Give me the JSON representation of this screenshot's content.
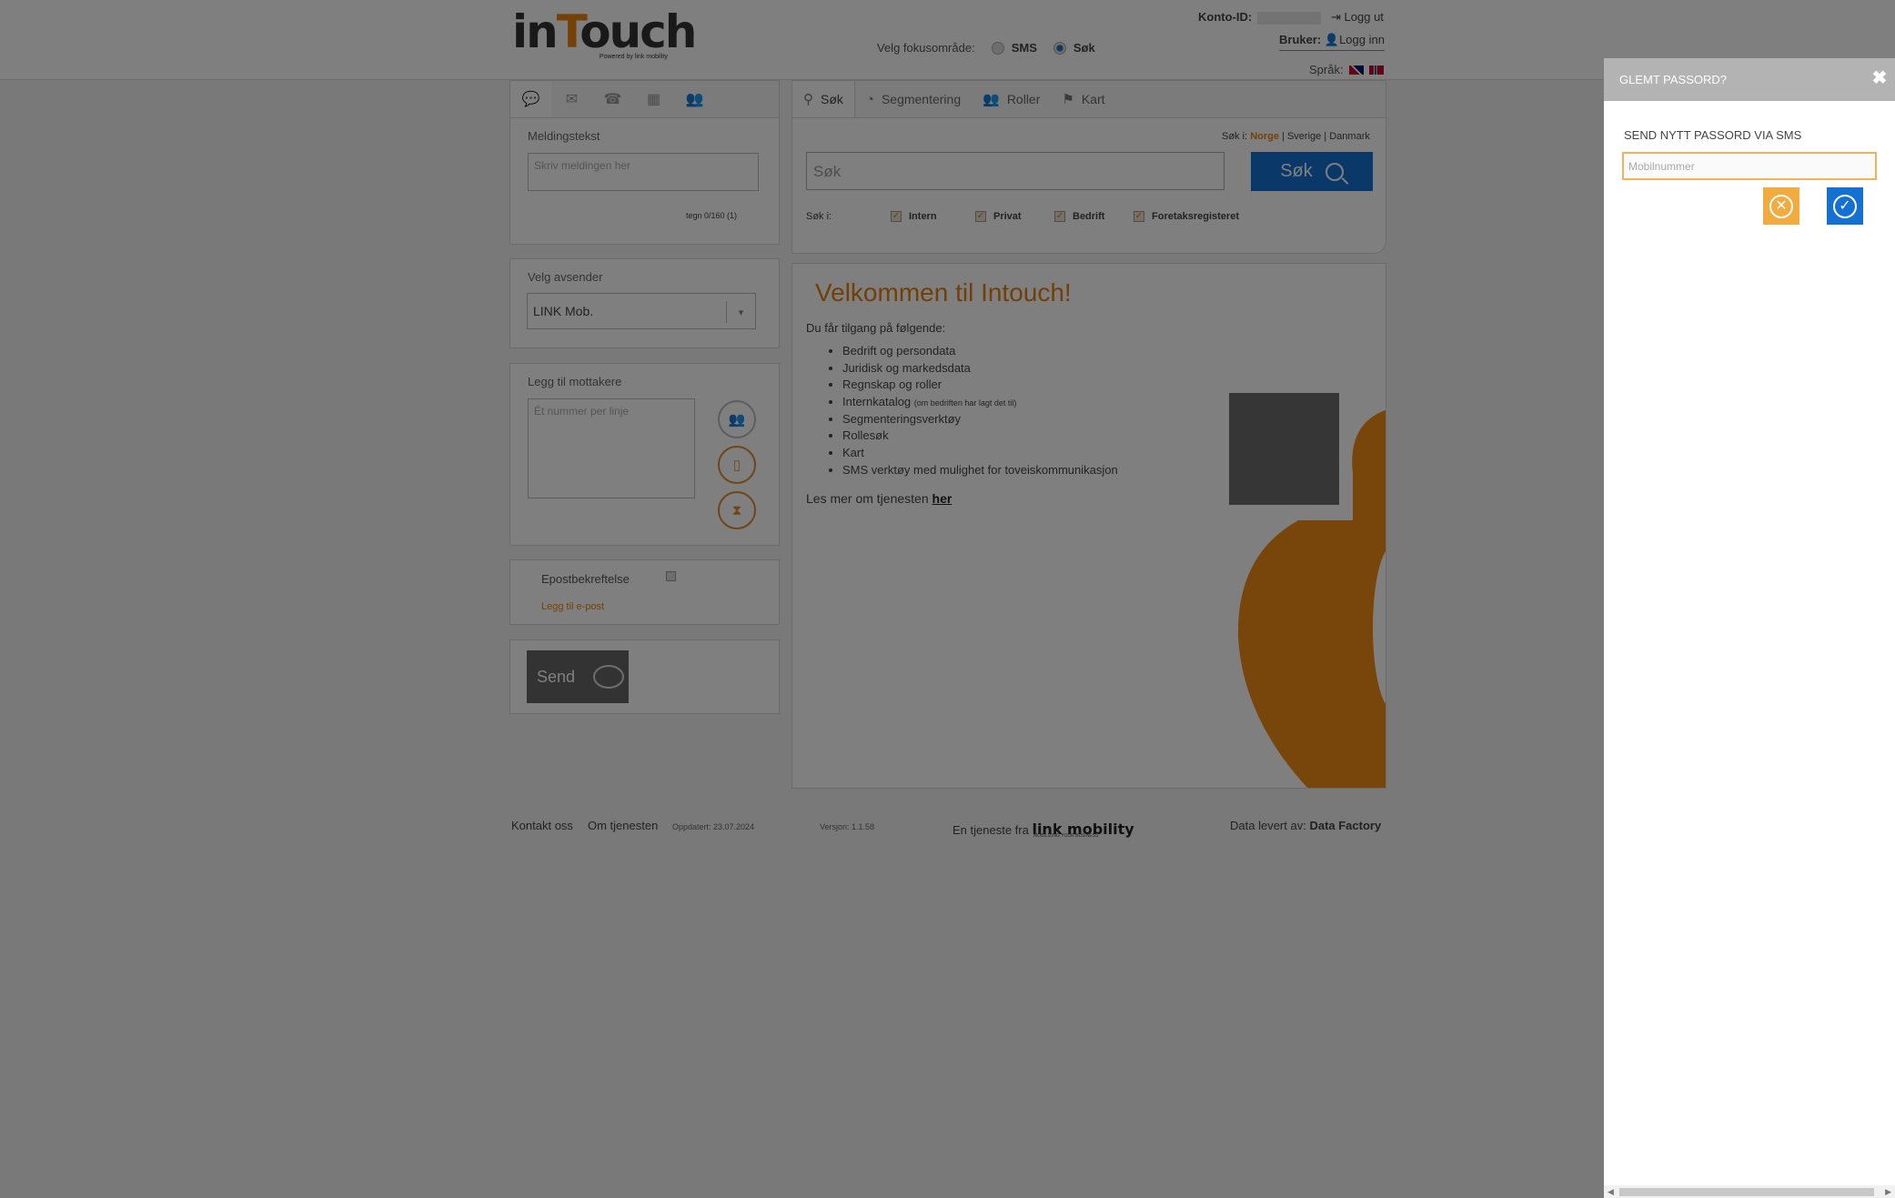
{
  "header": {
    "logo_text_a": "in",
    "logo_text_b": "T",
    "logo_text_c": "ouch",
    "logo_sub": "Powered by link mobility",
    "focus_label": "Velg fokusområde:",
    "focus_options": [
      "SMS",
      "Søk"
    ],
    "focus_selected": "Søk",
    "konto_label": "Konto-ID:",
    "logout_label": "Logg ut",
    "bruker_label": "Bruker:",
    "login_label": "Logg inn",
    "sprak_label": "Språk:"
  },
  "message": {
    "tabs": [
      "message-icon",
      "inbox-icon",
      "contacts-icon",
      "calendar-icon",
      "groups-icon"
    ],
    "label": "Meldingstekst",
    "placeholder": "Skriv meldingen her",
    "counter": "tegn 0/160 (1)"
  },
  "sender": {
    "label": "Velg avsender",
    "selected": "LINK Mob."
  },
  "recipients": {
    "label": "Legg til mottakere",
    "placeholder": "Ét nummer per linje"
  },
  "email": {
    "label": "Epostbekreftelse",
    "add_link": "Legg til e-post"
  },
  "send": {
    "label": "Send"
  },
  "search": {
    "tabs": [
      {
        "label": "Søk",
        "icon": "search-icon"
      },
      {
        "label": "Segmentering",
        "icon": "pie-icon"
      },
      {
        "label": "Roller",
        "icon": "people-icon"
      },
      {
        "label": "Kart",
        "icon": "map-icon"
      }
    ],
    "sok_i_label": "Søk i:",
    "countries": [
      "Norge",
      "Sverige",
      "Danmark"
    ],
    "active_country": "Norge",
    "placeholder": "Søk",
    "button": "Søk",
    "filter_label": "Søk i:",
    "filters": [
      "Intern",
      "Privat",
      "Bedrift",
      "Foretaksregisteret"
    ]
  },
  "welcome": {
    "title": "Velkommen til Intouch!",
    "intro": "Du får tilgang på følgende:",
    "features": [
      "Bedrift og persondata",
      "Juridisk og markedsdata",
      "Regnskap og roller",
      "Internkatalog",
      "Segmenteringsverktøy",
      "Rollesøk",
      "Kart",
      "SMS verktøy med mulighet for toveiskommunikasjon"
    ],
    "internkatalog_note": "(om bedriften har lagt det til)",
    "read_more": "Les mer om tjenesten",
    "read_more_link": "her"
  },
  "footer": {
    "contact": "Kontakt oss",
    "about": "Om tjenesten",
    "updated": "Oppdatert: 23.07.2024",
    "version": "Versjon: 1.1.58",
    "service_by": "En tjeneste fra",
    "link_logo": "link mobility",
    "link_tagline": "MOBILIZING YOUR BUSINESS",
    "data_by": "Data levert av:",
    "data_provider": "Data Factory"
  },
  "modal": {
    "title": "GLEMT PASSORD?",
    "subtitle": "SEND NYTT PASSORD VIA SMS",
    "placeholder": "Mobilnummer"
  },
  "colors": {
    "accent_orange": "#e8820f",
    "primary_blue": "#1471d2",
    "modal_header": "#b3b3b3"
  }
}
